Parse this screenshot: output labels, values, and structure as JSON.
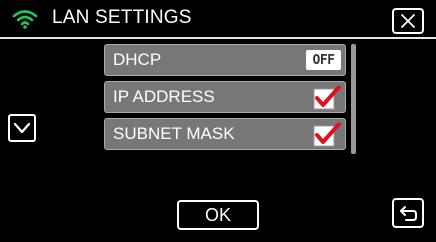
{
  "header": {
    "title": "LAN SETTINGS",
    "wifi_icon": "wifi-icon",
    "wifi_color": "#22c55e",
    "close_icon": "close-icon"
  },
  "settings": [
    {
      "label": "DHCP",
      "control": "toggle",
      "value": "OFF"
    },
    {
      "label": "IP ADDRESS",
      "control": "checkbox",
      "checked": true
    },
    {
      "label": "SUBNET MASK",
      "control": "checkbox",
      "checked": true
    }
  ],
  "navigation": {
    "down_icon": "chevron-down-icon",
    "back_icon": "back-arrow-icon"
  },
  "footer": {
    "ok_label": "OK"
  },
  "colors": {
    "background": "#000000",
    "row_background": "#777777",
    "check_color": "#e0101a"
  }
}
